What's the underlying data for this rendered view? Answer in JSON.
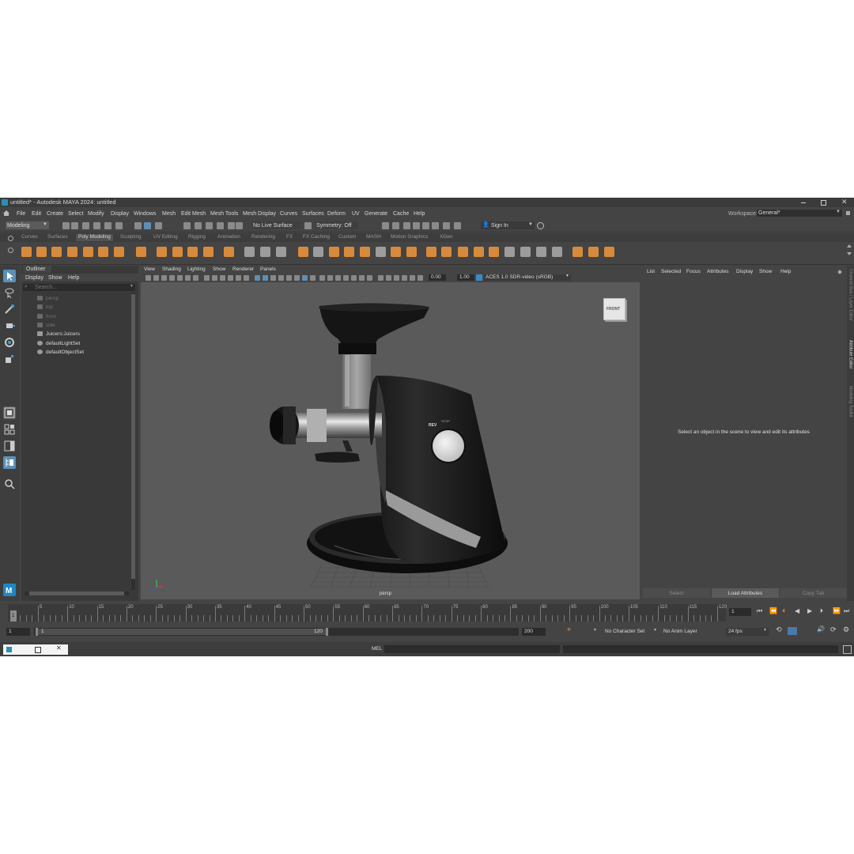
{
  "window": {
    "title": "untitled* - Autodesk MAYA 2024: untitled",
    "min_icon": "minimize-icon",
    "max_icon": "maximize-icon",
    "close_icon": "close-icon"
  },
  "menubar": {
    "items": [
      "File",
      "Edit",
      "Create",
      "Select",
      "Modify",
      "Display",
      "Windows",
      "Mesh",
      "Edit Mesh",
      "Mesh Tools",
      "Mesh Display",
      "Curves",
      "Surfaces",
      "Deform",
      "UV",
      "Generate",
      "Cache",
      "Help"
    ],
    "workspace_label": "Workspace:",
    "workspace_value": "General*"
  },
  "statusline": {
    "mode": "Modeling",
    "live_surface": "No Live Surface",
    "symmetry": "Symmetry: Off",
    "sign_in": "Sign In"
  },
  "shelf": {
    "tabs": [
      "Curves",
      "Surfaces",
      "Poly Modeling",
      "Sculpting",
      "UV Editing",
      "Rigging",
      "Animation",
      "Rendering",
      "FX",
      "FX Caching",
      "Custom",
      "MASH",
      "Motion Graphics",
      "XGen"
    ],
    "active_tab": "Poly Modeling"
  },
  "outliner": {
    "title": "Outliner",
    "menu": [
      "Display",
      "Show",
      "Help"
    ],
    "search_placeholder": "Search...",
    "items": [
      {
        "label": "persp",
        "dim": true,
        "icon": "camera-icon"
      },
      {
        "label": "top",
        "dim": true,
        "icon": "camera-icon"
      },
      {
        "label": "front",
        "dim": true,
        "icon": "camera-icon"
      },
      {
        "label": "side",
        "dim": true,
        "icon": "camera-icon"
      },
      {
        "label": "Juicers:Juicers",
        "dim": false,
        "icon": "transform-icon"
      },
      {
        "label": "defaultLightSet",
        "dim": false,
        "icon": "set-icon"
      },
      {
        "label": "defaultObjectSet",
        "dim": false,
        "icon": "set-icon"
      }
    ]
  },
  "viewport": {
    "menu": [
      "View",
      "Shading",
      "Lighting",
      "Show",
      "Renderer",
      "Panels"
    ],
    "exposure": "0.00",
    "gamma": "1.00",
    "color_space": "ACES 1.0 SDR-video (sRGB)",
    "camera_label": "persp",
    "viewcube_label": "FRONT",
    "model_labels": {
      "rev": "REV",
      "stop": "STOP"
    }
  },
  "attribute_editor": {
    "menu": [
      "List",
      "Selected",
      "Focus",
      "Attributes",
      "Display",
      "Show",
      "Help"
    ],
    "message": "Select an object in the scene to view and edit its attributes",
    "buttons": [
      "Select",
      "Load Attributes",
      "Copy Tab"
    ],
    "side_tabs": [
      "Channel Box / Layer Editor",
      "Attribute Editor",
      "Modeling Toolkit"
    ]
  },
  "timeline": {
    "ticks": [
      "5",
      "10",
      "15",
      "20",
      "25",
      "30",
      "35",
      "40",
      "45",
      "50",
      "55",
      "60",
      "65",
      "70",
      "75",
      "80",
      "85",
      "90",
      "95",
      "100",
      "105",
      "110",
      "115",
      "120"
    ],
    "current_marker": "1",
    "current_frame": "1"
  },
  "range": {
    "start": "1",
    "inner_start": "1",
    "inner_end": "120",
    "end": "200",
    "character_set": "No Character Set",
    "anim_layer": "No Anim Layer",
    "fps": "24 fps"
  },
  "cmdline": {
    "mel_label": "MEL"
  }
}
